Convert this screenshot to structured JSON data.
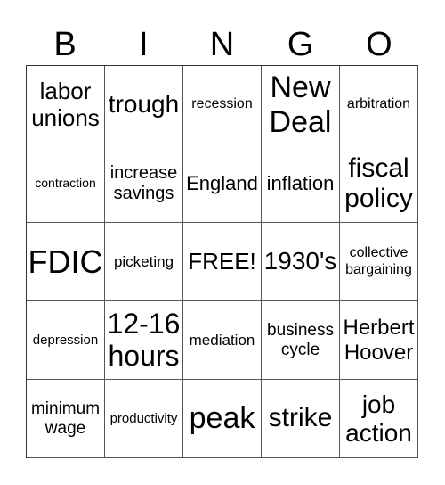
{
  "header": {
    "letters": [
      "B",
      "I",
      "N",
      "G",
      "O"
    ]
  },
  "card": {
    "rows": [
      [
        "labor\nunions",
        "trough",
        "recession",
        "New\nDeal",
        "arbitration"
      ],
      [
        "contraction",
        "increase\nsavings",
        "England",
        "inflation",
        "fiscal\npolicy"
      ],
      [
        "FDIC",
        "picketing",
        "FREE!",
        "1930's",
        "collective\nbargaining"
      ],
      [
        "depression",
        "12-16\nhours",
        "mediation",
        "business\ncycle",
        "Herbert\nHoover"
      ],
      [
        "minimum\nwage",
        "productivity",
        "peak",
        "strike",
        "job\naction"
      ]
    ],
    "free_space": "FREE!"
  }
}
